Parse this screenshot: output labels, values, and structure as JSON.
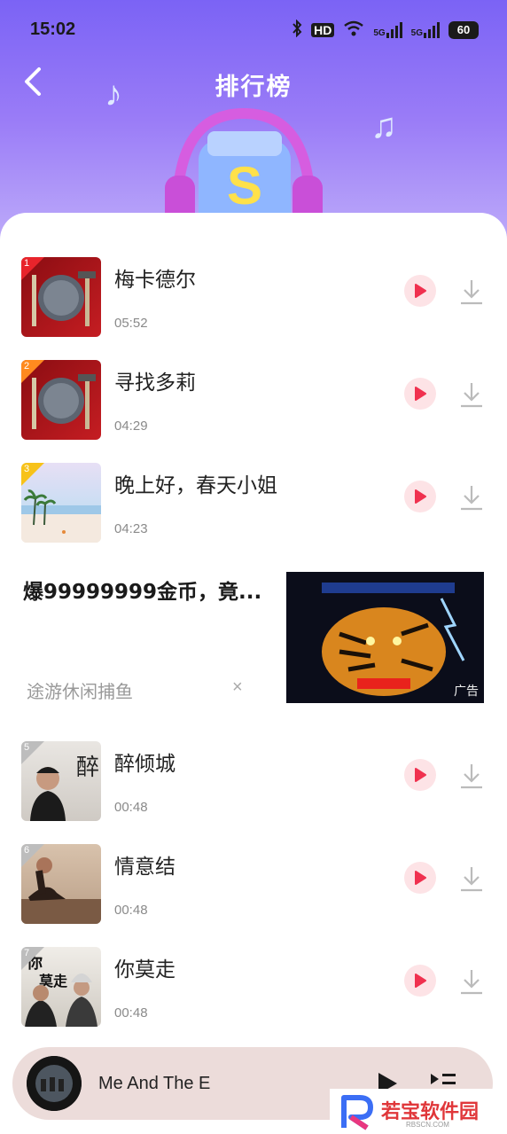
{
  "status_bar": {
    "time": "15:02",
    "icons": [
      "bluetooth-icon",
      "hd-icon",
      "wifi-icon",
      "signal-5g-icon",
      "signal-5g-icon"
    ],
    "hd_label": "HD",
    "net_label_1": "5G",
    "net_label_2": "5G",
    "battery": "60"
  },
  "header": {
    "title": "排行榜",
    "back_icon": "chevron-left-icon",
    "colors": {
      "gradient_top": "#7b63f5",
      "gradient_bottom": "#c4b4fa"
    }
  },
  "songs": [
    {
      "rank": "1",
      "title": "梅卡德尔",
      "duration": "05:52",
      "rank_color": "#e8242b"
    },
    {
      "rank": "2",
      "title": "寻找多莉",
      "duration": "04:29",
      "rank_color": "#ff8a1f"
    },
    {
      "rank": "3",
      "title": "晚上好，春天小姐",
      "duration": "04:23",
      "rank_color": "#f7c21a"
    },
    {
      "rank": "5",
      "title": "醉倾城",
      "duration": "00:48",
      "rank_color": "#bdbdbd"
    },
    {
      "rank": "6",
      "title": "情意结",
      "duration": "00:48",
      "rank_color": "#bdbdbd"
    },
    {
      "rank": "7",
      "title": "你莫走",
      "duration": "00:48",
      "rank_color": "#bdbdbd"
    }
  ],
  "ad": {
    "title": "爆99999999金币，竟...",
    "source": "途游休闲捕鱼",
    "close": "×",
    "label": "广告"
  },
  "player": {
    "title": "Me And The E",
    "play_icon": "play-icon",
    "queue_icon": "playlist-icon"
  },
  "watermark": {
    "text": "若宝软件园",
    "sub": "RBSCN.COM"
  },
  "accent": "#f0314f"
}
